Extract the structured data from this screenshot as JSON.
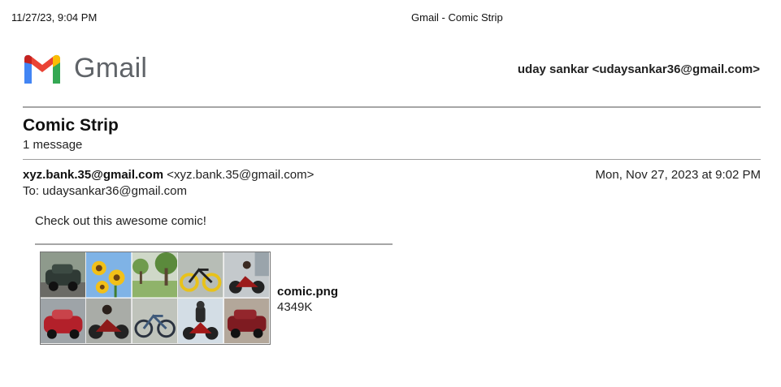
{
  "print_header": {
    "datetime": "11/27/23, 9:04 PM",
    "page_title": "Gmail - Comic Strip"
  },
  "brand": {
    "name": "Gmail",
    "colors": {
      "blue": "#4285F4",
      "red": "#EA4335",
      "yellow": "#FBBC04",
      "green": "#34A853",
      "darkred": "#C5221F"
    }
  },
  "account": {
    "label": "uday sankar <udaysankar36@gmail.com>"
  },
  "thread": {
    "subject": "Comic Strip",
    "message_count": "1 message"
  },
  "message": {
    "from_email": "xyz.bank.35@gmail.com",
    "from_address": "<xyz.bank.35@gmail.com>",
    "date": "Mon, Nov 27, 2023 at 9:02 PM",
    "to": "To: udaysankar36@gmail.com",
    "body": "Check out this awesome comic!"
  },
  "attachment": {
    "filename": "comic.png",
    "size": "4349K",
    "thumbnail_panels": [
      "vintage-car",
      "sunflowers",
      "park",
      "yellow-bicycle",
      "motorcycle",
      "red-car",
      "motorcycle",
      "bicycle",
      "motorcycle-rider",
      "red-car"
    ]
  }
}
